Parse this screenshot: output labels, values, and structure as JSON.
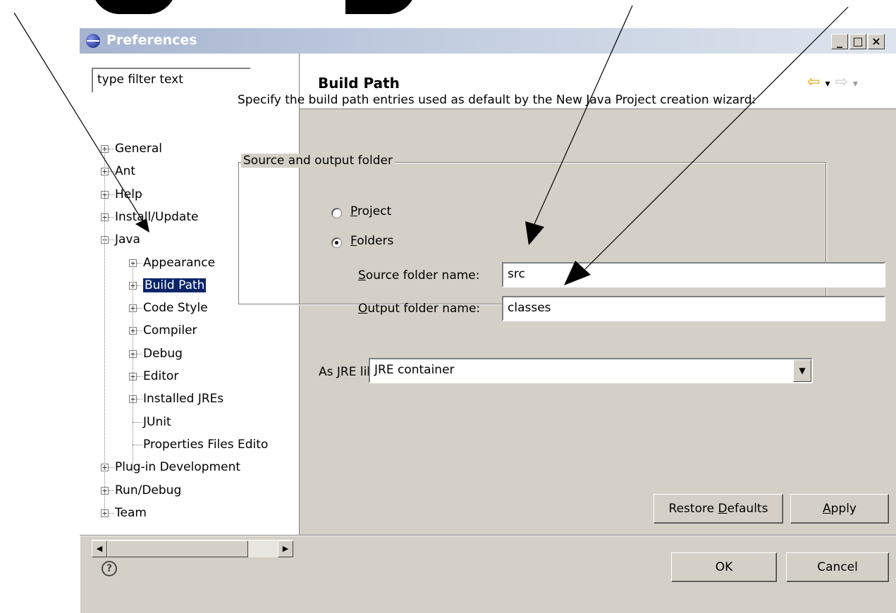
{
  "window": {
    "title": "Preferences",
    "controls": {
      "minimize": "_",
      "maximize": "□",
      "close": "×"
    }
  },
  "filter": {
    "value": "type filter text"
  },
  "tree": [
    {
      "label": "General",
      "expander": "+"
    },
    {
      "label": "Ant",
      "expander": "+"
    },
    {
      "label": "Help",
      "expander": "+"
    },
    {
      "label": "Install/Update",
      "expander": "+"
    },
    {
      "label": "Java",
      "expander": "−"
    },
    {
      "label": "Appearance",
      "expander": "+"
    },
    {
      "label": "Build Path",
      "expander": "+",
      "selected": true
    },
    {
      "label": "Code Style",
      "expander": "+"
    },
    {
      "label": "Compiler",
      "expander": "+"
    },
    {
      "label": "Debug",
      "expander": "+"
    },
    {
      "label": "Editor",
      "expander": "+"
    },
    {
      "label": "Installed JREs",
      "expander": "+"
    },
    {
      "label": "JUnit",
      "expander": ""
    },
    {
      "label": "Properties Files Edito",
      "expander": ""
    },
    {
      "label": "Plug-in Development",
      "expander": "+"
    },
    {
      "label": "Run/Debug",
      "expander": "+"
    },
    {
      "label": "Team",
      "expander": "+"
    }
  ],
  "page": {
    "title": "Build Path",
    "description": "Specify the build path entries used as default by the New Java Project creation wizard:",
    "group_label": "Source and output folder",
    "radio_project": {
      "mnemonic": "P",
      "rest": "roject",
      "selected": false
    },
    "radio_folders": {
      "mnemonic": "F",
      "rest": "olders",
      "selected": true
    },
    "source_label": {
      "mnemonic": "S",
      "rest": "ource folder name:"
    },
    "source_value": "src",
    "output_label": {
      "mnemonic": "O",
      "rest": "utput folder name:"
    },
    "output_value": "classes",
    "jre_label": {
      "pre": "As ",
      "mnemonic": "J",
      "rest": "RE library use:"
    },
    "jre_value": "JRE container"
  },
  "buttons": {
    "restore": {
      "pre": "Restore ",
      "mnemonic": "D",
      "rest": "efaults"
    },
    "apply": {
      "mnemonic": "A",
      "rest": "pply"
    },
    "ok": "OK",
    "cancel": "Cancel"
  },
  "icons": {
    "back": "⇦",
    "forward": "⇨",
    "dropdown": "▾",
    "help": "?",
    "scroll_left": "◀",
    "scroll_right": "▶",
    "combo": "▼"
  }
}
